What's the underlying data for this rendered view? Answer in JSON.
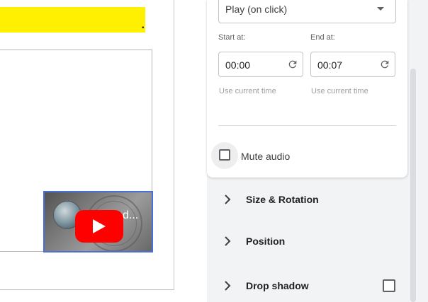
{
  "canvas": {
    "highlight_color": "#ffef00",
    "trailing_text": ".",
    "video": {
      "title_fragment": "d...",
      "play_icon": "youtube-play-icon",
      "brand_color": "#ff0000"
    }
  },
  "panel": {
    "play_mode": {
      "value": "Play (on click)",
      "icon": "chevron-down-icon"
    },
    "start": {
      "label": "Start at:",
      "value": "00:00",
      "hint": "Use current time",
      "icon": "reset-icon"
    },
    "end": {
      "label": "End at:",
      "value": "00:07",
      "hint": "Use current time",
      "icon": "reset-icon"
    },
    "mute": {
      "label": "Mute audio",
      "checked": false
    },
    "sections": [
      {
        "title": "Size & Rotation",
        "icon": "chevron-right-icon"
      },
      {
        "title": "Position",
        "icon": "chevron-right-icon"
      },
      {
        "title": "Drop shadow",
        "icon": "chevron-right-icon",
        "checked": false
      }
    ]
  }
}
